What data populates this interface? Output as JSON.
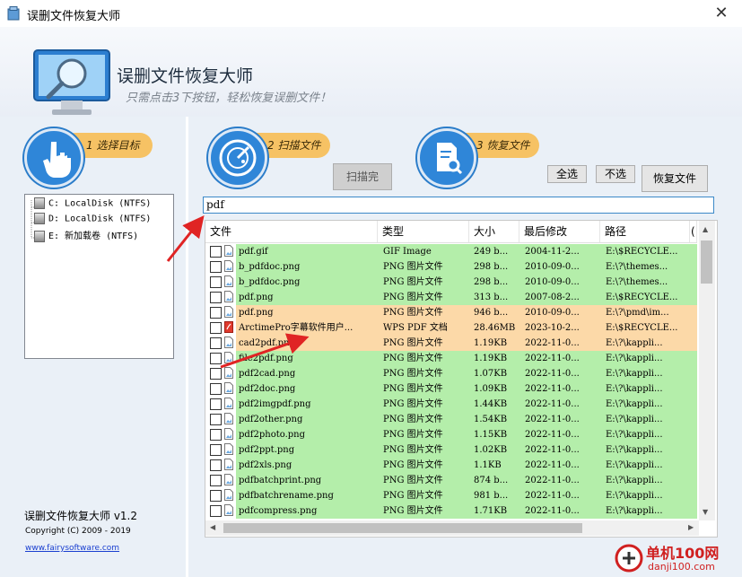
{
  "window": {
    "title": "误删文件恢复大师",
    "close_glyph": "✕"
  },
  "header": {
    "app_name": "误删文件恢复大师",
    "slogan": "只需点击3下按钮，轻松恢复误删文件！"
  },
  "steps": [
    {
      "label": "1 选择目标",
      "icon": "hand-pointer-icon"
    },
    {
      "label": "2 扫描文件",
      "icon": "radar-icon"
    },
    {
      "label": "3 恢复文件",
      "icon": "document-search-icon"
    }
  ],
  "buttons": {
    "scan_done": "扫描完",
    "select_all": "全选",
    "deselect": "不选",
    "recover": "恢复文件"
  },
  "drives": [
    {
      "label": "C: LocalDisk (NTFS)"
    },
    {
      "label": "D: LocalDisk (NTFS)"
    },
    {
      "label": "E: 新加载卷 (NTFS)"
    }
  ],
  "filter": {
    "value": "pdf"
  },
  "columns": [
    "文件",
    "类型",
    "大小",
    "最后修改",
    "路径",
    "("
  ],
  "rows": [
    {
      "name": "pdf.gif",
      "type": "GIF Image",
      "size": "249 b...",
      "modified": "2004-11-2...",
      "path": "E:\\$RECYCLE...",
      "status": "green",
      "icon": "image-file-icon"
    },
    {
      "name": "b_pdfdoc.png",
      "type": "PNG 图片文件",
      "size": "298 b...",
      "modified": "2010-09-0...",
      "path": "E:\\?\\themes...",
      "status": "green",
      "icon": "image-file-icon"
    },
    {
      "name": "b_pdfdoc.png",
      "type": "PNG 图片文件",
      "size": "298 b...",
      "modified": "2010-09-0...",
      "path": "E:\\?\\themes...",
      "status": "green",
      "icon": "image-file-icon"
    },
    {
      "name": "pdf.png",
      "type": "PNG 图片文件",
      "size": "313 b...",
      "modified": "2007-08-2...",
      "path": "E:\\$RECYCLE...",
      "status": "green",
      "icon": "image-file-icon"
    },
    {
      "name": "pdf.png",
      "type": "PNG 图片文件",
      "size": "946 b...",
      "modified": "2010-09-0...",
      "path": "E:\\?\\pmd\\im...",
      "status": "orange",
      "icon": "image-file-icon"
    },
    {
      "name": "ArctimePro字幕软件用户...",
      "type": "WPS PDF 文档",
      "size": "28.46MB",
      "modified": "2023-10-2...",
      "path": "E:\\$RECYCLE...",
      "status": "orange",
      "icon": "pdf-file-icon"
    },
    {
      "name": "cad2pdf.png",
      "type": "PNG 图片文件",
      "size": "1.19KB",
      "modified": "2022-11-0...",
      "path": "E:\\?\\kappli...",
      "status": "orange",
      "icon": "image-file-icon"
    },
    {
      "name": "file2pdf.png",
      "type": "PNG 图片文件",
      "size": "1.19KB",
      "modified": "2022-11-0...",
      "path": "E:\\?\\kappli...",
      "status": "green",
      "icon": "image-file-icon"
    },
    {
      "name": "pdf2cad.png",
      "type": "PNG 图片文件",
      "size": "1.07KB",
      "modified": "2022-11-0...",
      "path": "E:\\?\\kappli...",
      "status": "green",
      "icon": "image-file-icon"
    },
    {
      "name": "pdf2doc.png",
      "type": "PNG 图片文件",
      "size": "1.09KB",
      "modified": "2022-11-0...",
      "path": "E:\\?\\kappli...",
      "status": "green",
      "icon": "image-file-icon"
    },
    {
      "name": "pdf2imgpdf.png",
      "type": "PNG 图片文件",
      "size": "1.44KB",
      "modified": "2022-11-0...",
      "path": "E:\\?\\kappli...",
      "status": "green",
      "icon": "image-file-icon"
    },
    {
      "name": "pdf2other.png",
      "type": "PNG 图片文件",
      "size": "1.54KB",
      "modified": "2022-11-0...",
      "path": "E:\\?\\kappli...",
      "status": "green",
      "icon": "image-file-icon"
    },
    {
      "name": "pdf2photo.png",
      "type": "PNG 图片文件",
      "size": "1.15KB",
      "modified": "2022-11-0...",
      "path": "E:\\?\\kappli...",
      "status": "green",
      "icon": "image-file-icon"
    },
    {
      "name": "pdf2ppt.png",
      "type": "PNG 图片文件",
      "size": "1.02KB",
      "modified": "2022-11-0...",
      "path": "E:\\?\\kappli...",
      "status": "green",
      "icon": "image-file-icon"
    },
    {
      "name": "pdf2xls.png",
      "type": "PNG 图片文件",
      "size": "1.1KB",
      "modified": "2022-11-0...",
      "path": "E:\\?\\kappli...",
      "status": "green",
      "icon": "image-file-icon"
    },
    {
      "name": "pdfbatchprint.png",
      "type": "PNG 图片文件",
      "size": "874 b...",
      "modified": "2022-11-0...",
      "path": "E:\\?\\kappli...",
      "status": "green",
      "icon": "image-file-icon"
    },
    {
      "name": "pdfbatchrename.png",
      "type": "PNG 图片文件",
      "size": "981 b...",
      "modified": "2022-11-0...",
      "path": "E:\\?\\kappli...",
      "status": "green",
      "icon": "image-file-icon"
    },
    {
      "name": "pdfcompress.png",
      "type": "PNG 图片文件",
      "size": "1.71KB",
      "modified": "2022-11-0...",
      "path": "E:\\?\\kappli...",
      "status": "green",
      "icon": "image-file-icon"
    }
  ],
  "status_colors": {
    "green": "#b4eeaa",
    "orange": "#fcd9a8"
  },
  "accent_color": "#2f86d8",
  "footer": {
    "name": "误删文件恢复大师 v1.2",
    "copyright": "Copyright (C) 2009 - 2019",
    "url": "www.fairysoftware.com"
  },
  "watermark": {
    "name": "单机100网",
    "url": "danji100.com"
  }
}
